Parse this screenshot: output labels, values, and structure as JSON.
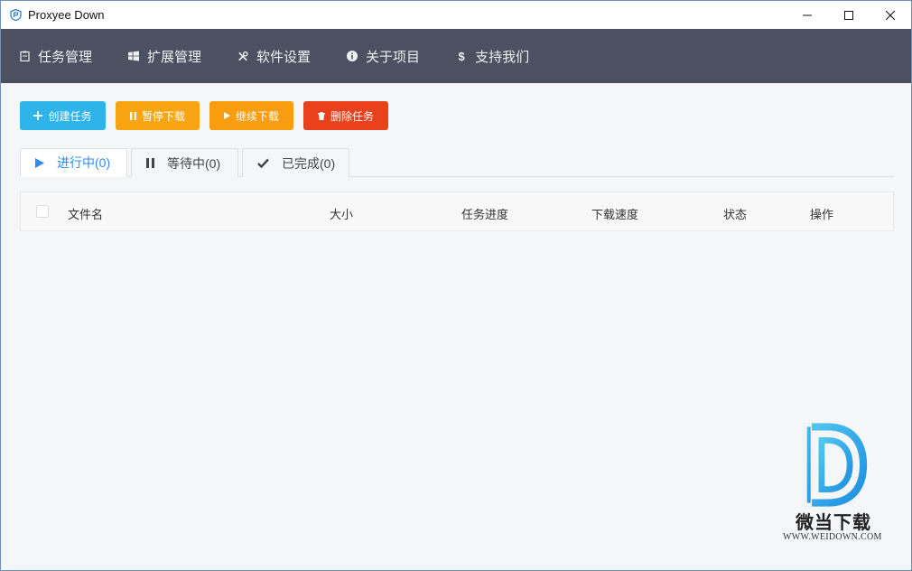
{
  "window": {
    "title": "Proxyee Down",
    "icon": "proxyee-shield-icon",
    "controls": [
      "minimize-icon",
      "maximize-icon",
      "close-icon"
    ]
  },
  "nav": {
    "items": [
      {
        "label": "任务管理",
        "icon": "clipboard-icon"
      },
      {
        "label": "扩展管理",
        "icon": "windows-icon"
      },
      {
        "label": "软件设置",
        "icon": "tools-icon"
      },
      {
        "label": "关于项目",
        "icon": "info-icon"
      },
      {
        "label": "支持我们",
        "icon": "dollar-icon"
      }
    ]
  },
  "toolbar": {
    "create": "创建任务",
    "pause": "暂停下载",
    "resume": "继续下载",
    "delete": "删除任务"
  },
  "tabs": [
    {
      "label": "进行中(0)",
      "icon": "play-icon",
      "active": true
    },
    {
      "label": "等待中(0)",
      "icon": "pause-icon",
      "active": false
    },
    {
      "label": "已完成(0)",
      "icon": "check-icon",
      "active": false
    }
  ],
  "table": {
    "columns": [
      "文件名",
      "大小",
      "任务进度",
      "下载速度",
      "状态",
      "操作"
    ],
    "rows": []
  },
  "watermark": {
    "cn": "微当下载",
    "en": "WWW.WEIDOWN.COM"
  },
  "colors": {
    "nav_bg": "#4b5160",
    "create": "#2fb4ea",
    "pause": "#f8a514",
    "resume": "#f89d10",
    "delete": "#e8411c",
    "active_tab": "#2d8cf0"
  }
}
